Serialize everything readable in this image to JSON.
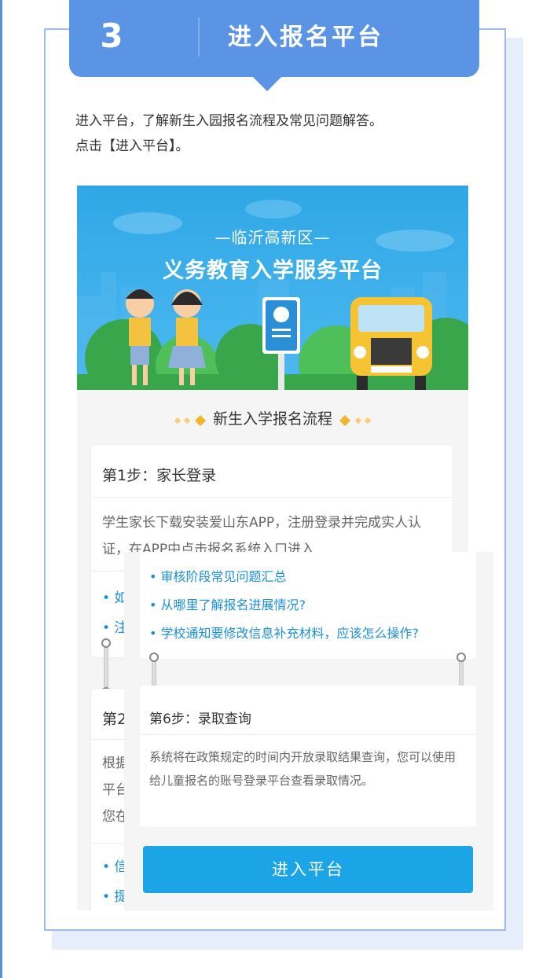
{
  "header": {
    "step_number": "3",
    "title": "进入报名平台"
  },
  "intro": {
    "line1": "进入平台，了解新生入园报名流程及常见问题解答。",
    "line2": "点击【进入平台】。"
  },
  "banner": {
    "subtitle": "—临沂高新区—",
    "title": "义务教育入学服务平台"
  },
  "flow": {
    "heading": "新生入学报名流程"
  },
  "step1": {
    "title": "第1步：家长登录",
    "body": "学生家长下载安装爱山东APP，注册登录并完成实人认证，在APP中点击报名系统入口进入",
    "links": [
      "• 如",
      "• 注"
    ]
  },
  "step2": {
    "title": "第2",
    "body_fragments": [
      "根据",
      "平台",
      "您在"
    ],
    "links": [
      "• 信",
      "• 提"
    ]
  },
  "faq": {
    "links": [
      "• 审核阶段常见问题汇总",
      "• 从哪里了解报名进展情况?",
      "• 学校通知要修改信息补充材料，应该怎么操作?"
    ]
  },
  "step6": {
    "title": "第6步：录取查询",
    "body": "系统将在政策规定的时间内开放录取结果查询，您可以使用给儿童报名的账号登录平台查看录取情况。"
  },
  "enter_button": "进入平台",
  "colors": {
    "header_blue": "#5b94e4",
    "banner_blue": "#2fa7e6",
    "button_blue": "#1ba5e6",
    "link_blue": "#1c8fd8",
    "accent_gold": "#f2b530"
  }
}
